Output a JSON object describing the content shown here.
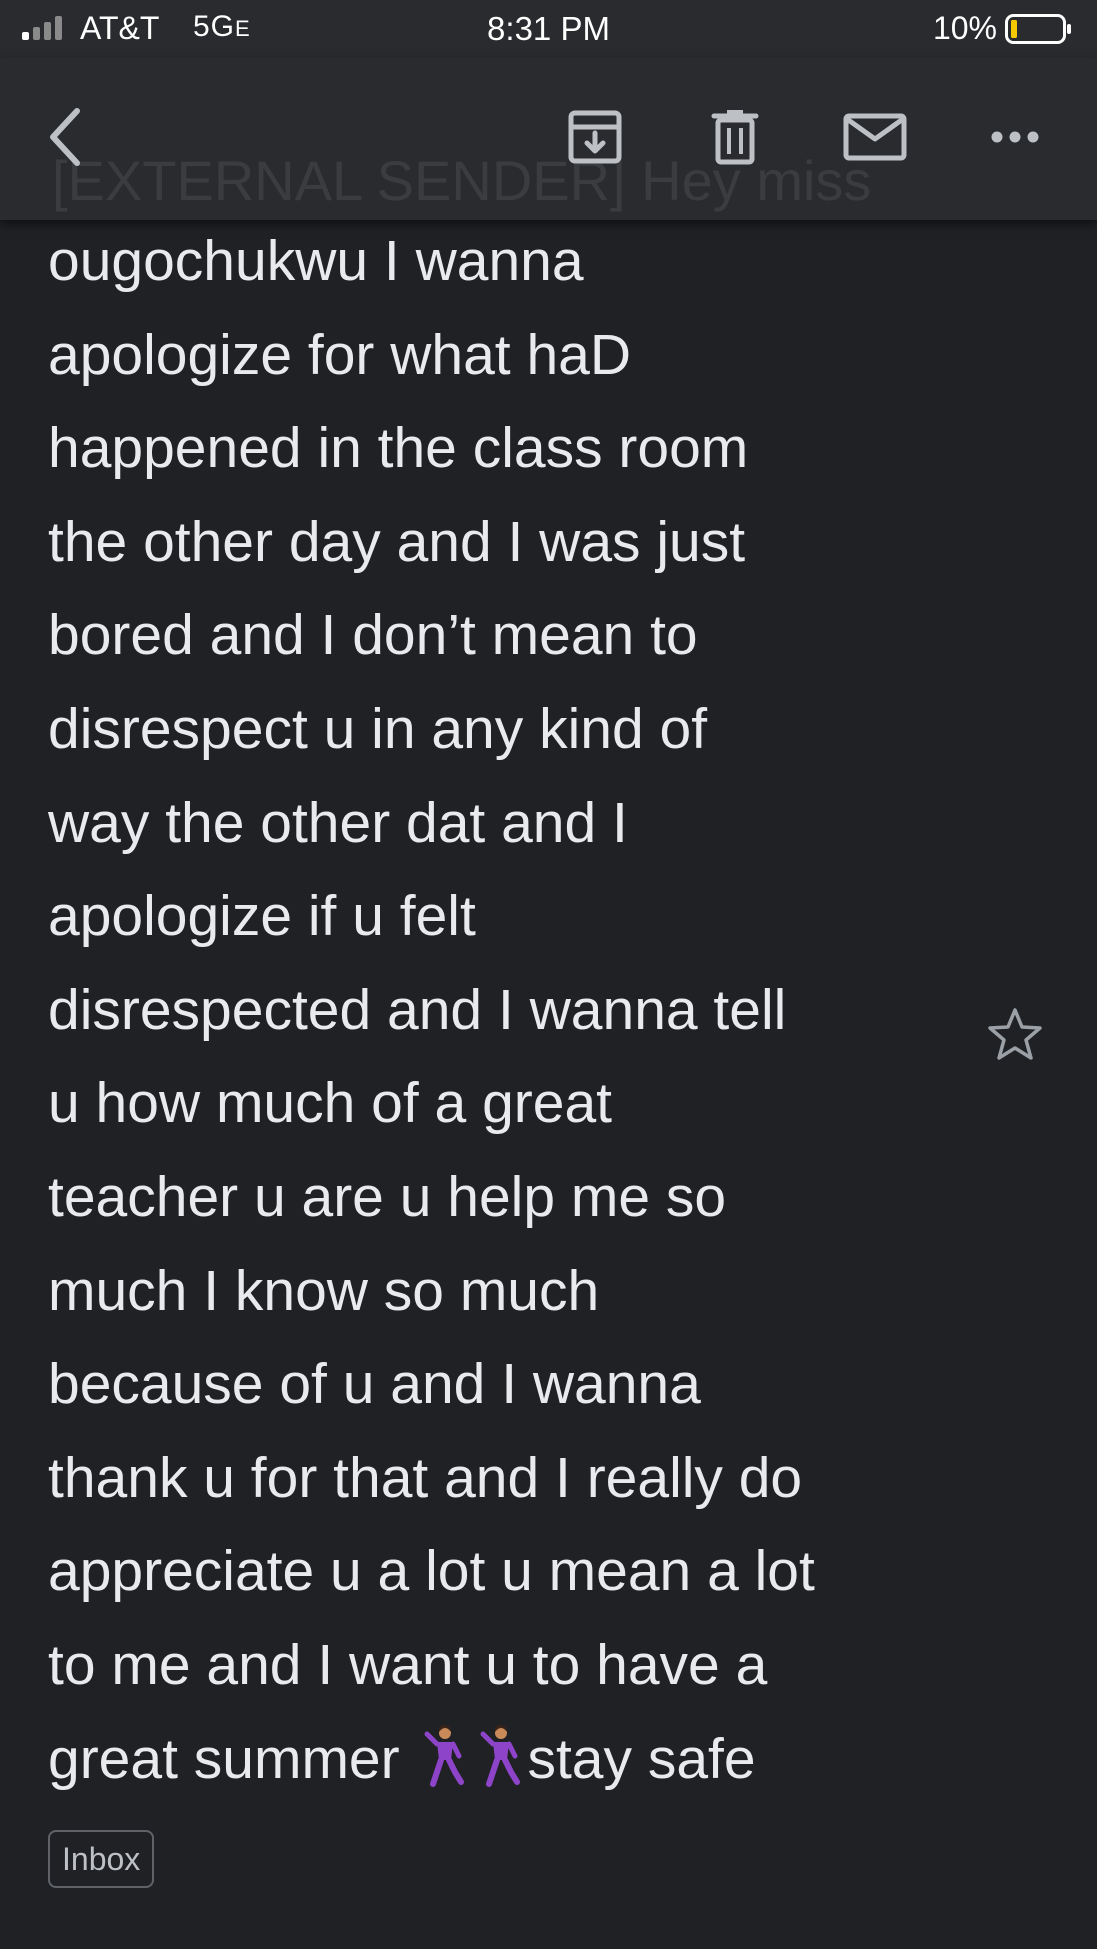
{
  "status_bar": {
    "carrier": "AT&T",
    "network": "5G",
    "network_suffix": "E",
    "time": "8:31 PM",
    "battery": "10%"
  },
  "toolbar": {
    "faded_subject": "[EXTERNAL SENDER] Hey miss",
    "icons": [
      "back-arrow-icon",
      "archive-icon",
      "trash-icon",
      "mail-icon",
      "more-icon"
    ]
  },
  "email": {
    "body_lines": [
      "ougochukwu I wanna",
      "apologize for what haD",
      "happened in the class room",
      "the other day and I was just",
      "bored and I don’t mean to",
      "disrespect u in any kind of",
      "way the other dat and I",
      "apologize if u felt",
      "disrespected and I wanna tell",
      "u how much of a great",
      "teacher u are u help me so",
      "much I know so much",
      "because of u and I wanna",
      "thank u for that and I really do",
      "appreciate u a lot u mean a lot",
      "to me and I want u to have a"
    ],
    "last_line_start": "great summer",
    "last_line_end": "stay safe",
    "emojis": [
      "dancer-emoji",
      "dancer-emoji"
    ],
    "label": "Inbox"
  },
  "colors": {
    "background": "#202124",
    "toolbar": "#2a2b2e",
    "text": "#e8eaed",
    "battery_low": "#f5c800",
    "emoji_purple": "#8e44c9"
  }
}
